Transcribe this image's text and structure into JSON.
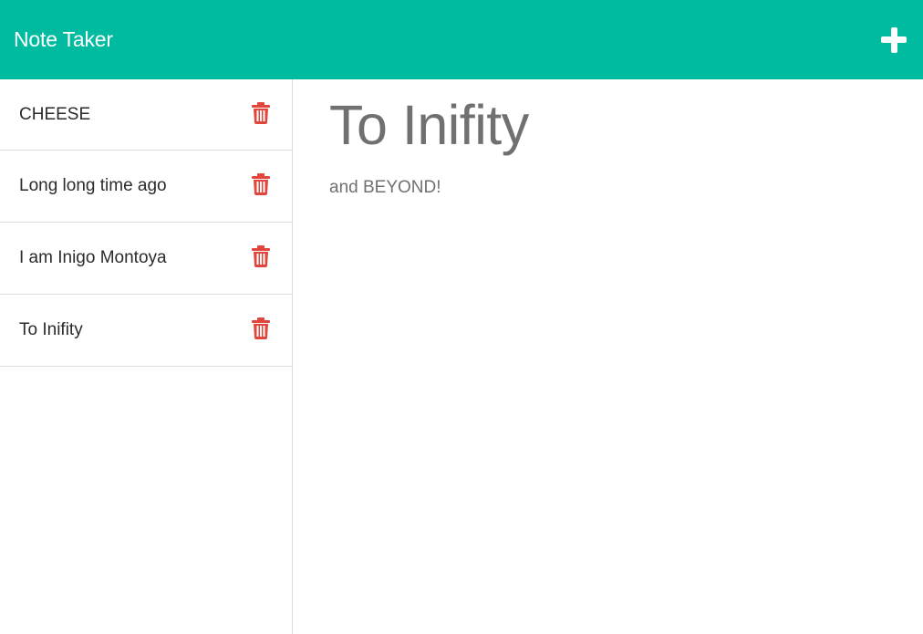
{
  "app": {
    "title": "Note Taker",
    "accent_color": "#00bb9f",
    "delete_color": "#e0463b"
  },
  "toolbar": {
    "new_note_icon": "plus-icon"
  },
  "sidebar": {
    "notes": [
      {
        "label": "CHEESE",
        "delete_icon": "trash-icon"
      },
      {
        "label": "Long long time ago",
        "delete_icon": "trash-icon"
      },
      {
        "label": "I am Inigo Montoya",
        "delete_icon": "trash-icon"
      },
      {
        "label": "To Inifity",
        "delete_icon": "trash-icon"
      }
    ]
  },
  "main": {
    "title": "To Inifity",
    "body": "and BEYOND!"
  }
}
